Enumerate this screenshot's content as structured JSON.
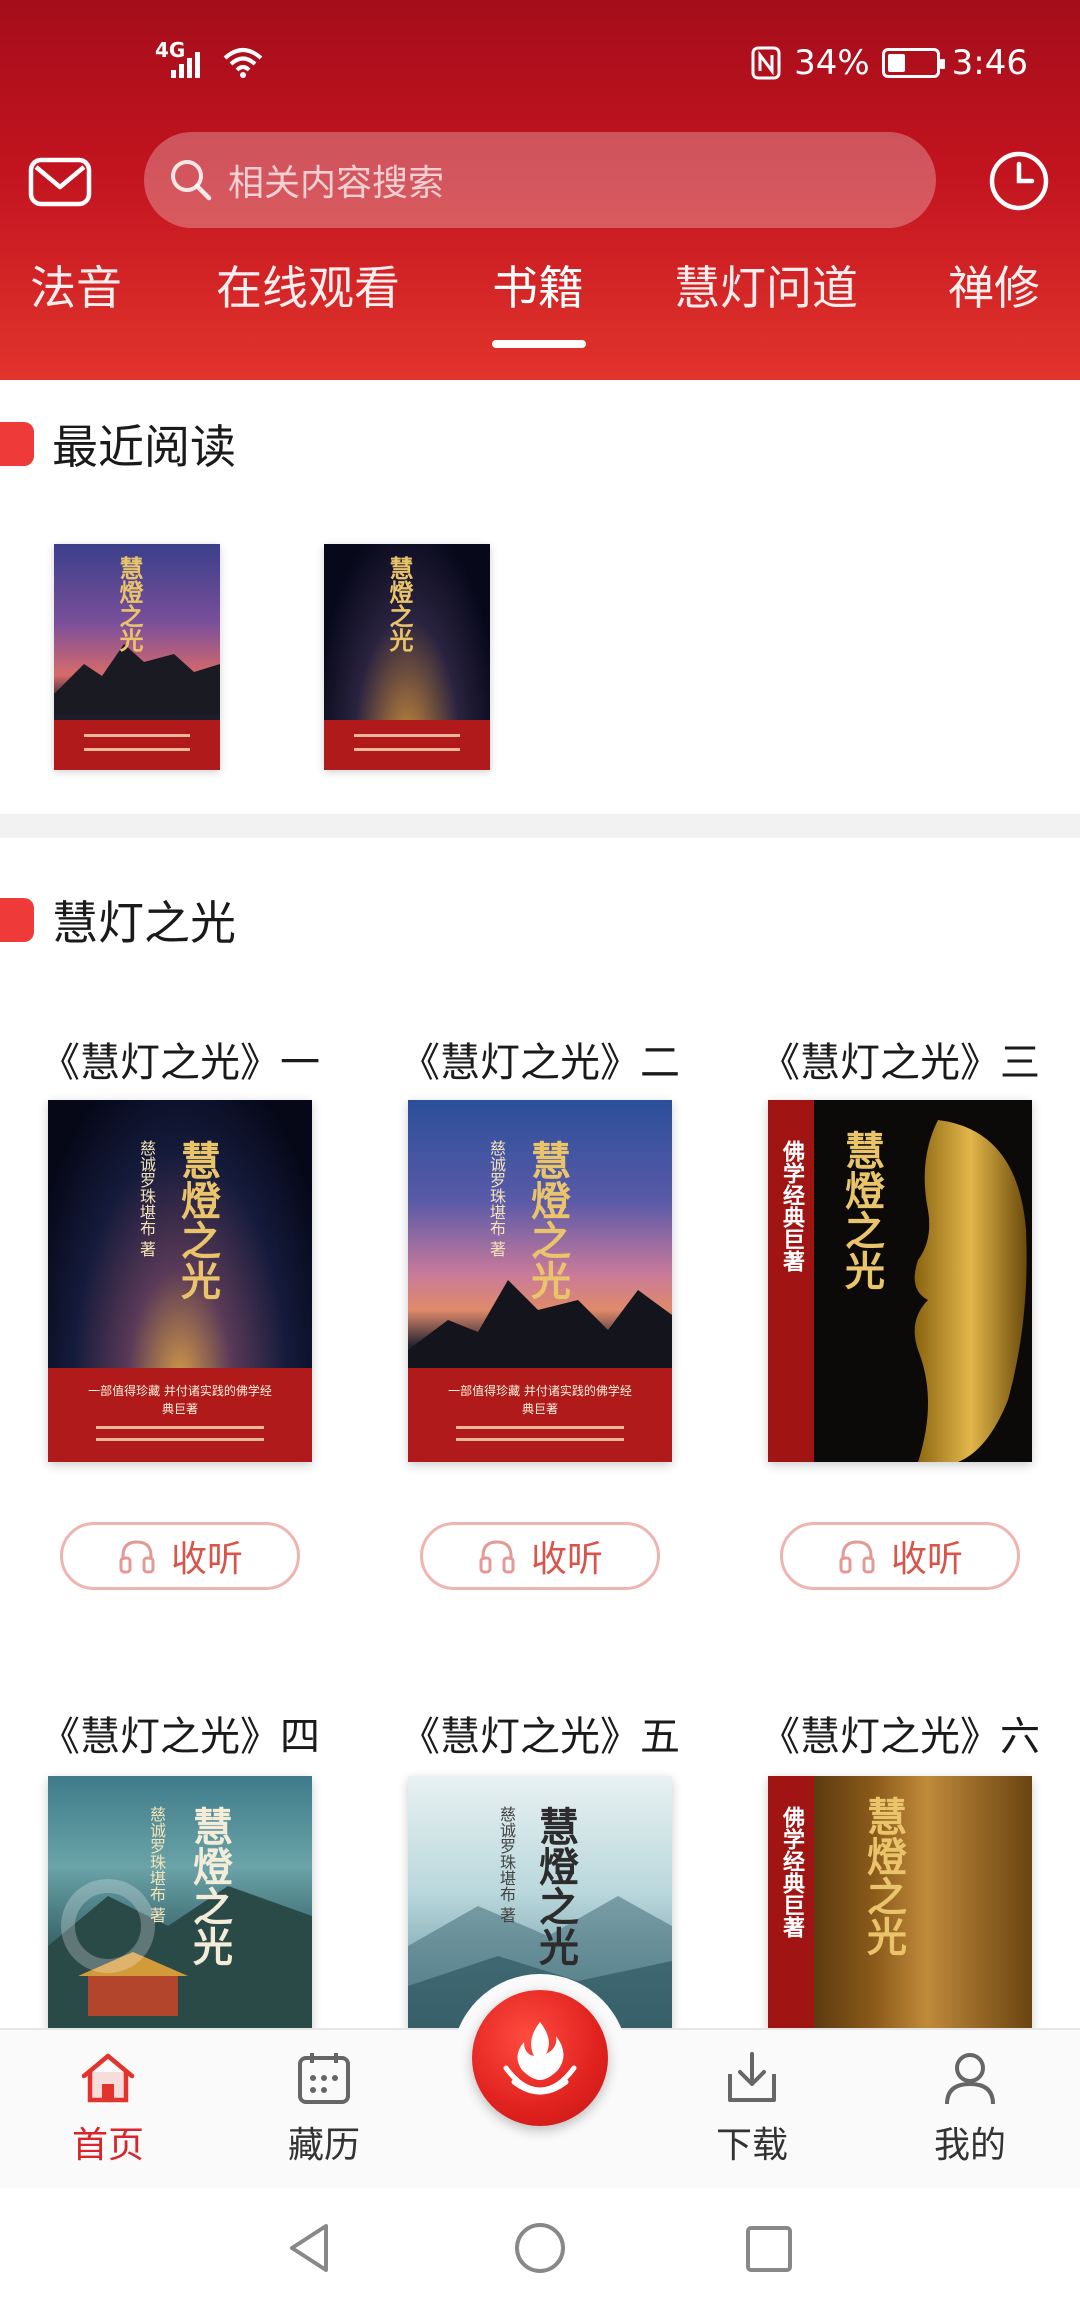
{
  "status": {
    "network": "4G",
    "battery_percent": "34%",
    "battery_level": 0.34,
    "time": "3:46"
  },
  "header": {
    "search_placeholder": "相关内容搜索",
    "tabs": [
      {
        "label": "法音"
      },
      {
        "label": "在线观看"
      },
      {
        "label": "书籍",
        "active": true
      },
      {
        "label": "慧灯问道"
      },
      {
        "label": "禅修"
      }
    ]
  },
  "sections": {
    "recent": {
      "title": "最近阅读"
    },
    "series": {
      "title": "慧灯之光"
    }
  },
  "cover_text": {
    "title_vertical": "慧燈之光",
    "author_vertical": "慈诚罗珠堪布 著",
    "tagline": "一部值得珍藏 并付诸实践的佛学经典巨著",
    "big_vertical": "佛学经典巨著"
  },
  "books": [
    {
      "title": "《慧灯之光》一",
      "listen_label": "收听"
    },
    {
      "title": "《慧灯之光》二",
      "listen_label": "收听"
    },
    {
      "title": "《慧灯之光》三",
      "listen_label": "收听"
    },
    {
      "title": "《慧灯之光》四"
    },
    {
      "title": "《慧灯之光》五"
    },
    {
      "title": "《慧灯之光》六"
    }
  ],
  "bottom_nav": [
    {
      "label": "首页",
      "icon": "home-icon",
      "active": true
    },
    {
      "label": "藏历",
      "icon": "calendar-icon"
    },
    {
      "label": "",
      "icon": "flame-logo-icon"
    },
    {
      "label": "下载",
      "icon": "download-icon"
    },
    {
      "label": "我的",
      "icon": "user-icon"
    }
  ],
  "colors": {
    "brand_red": "#c2141f",
    "accent_red": "#ef3a3a",
    "listen_text": "#d8554c"
  }
}
